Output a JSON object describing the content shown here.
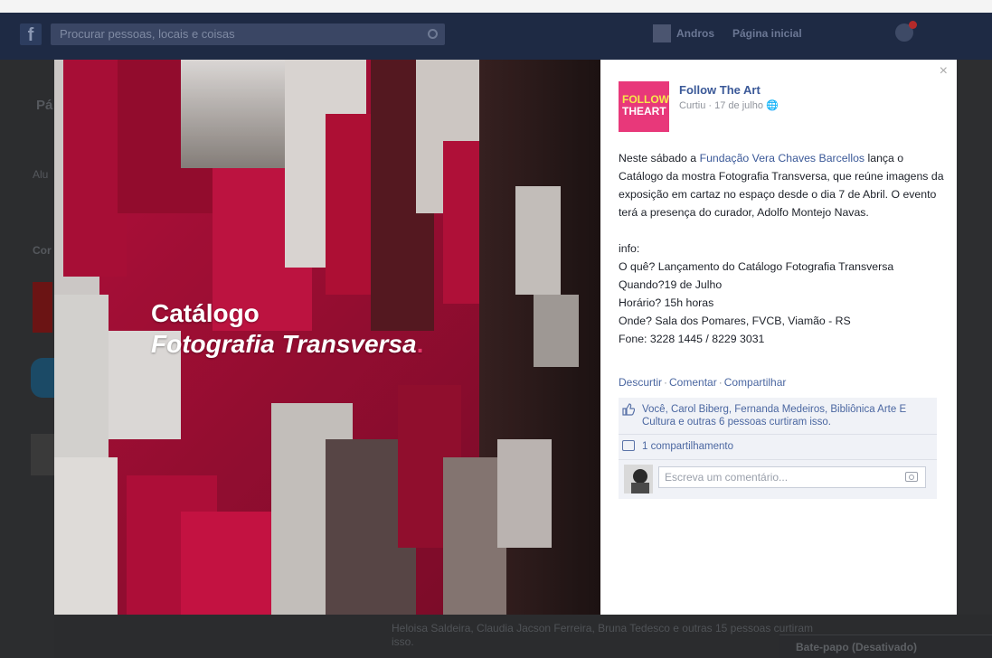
{
  "topbar": {
    "logo": "f",
    "search_placeholder": "Procurar pessoas, locais e coisas",
    "nav_profile": "Andros",
    "nav_home": "Página inicial"
  },
  "background": {
    "tab_label": "Pá",
    "left_label": "Alu",
    "left_label2": "Cor",
    "bottom_text": "Heloisa Saldeira, Claudia Jacson Ferreira, Bruna Tedesco e outras 15 pessoas curtiram isso.",
    "chat": "Bate-papo (Desativado)"
  },
  "photo": {
    "title_line1": "Catálogo",
    "title_line2": "Fotografia Transversa",
    "title_dot": "."
  },
  "post": {
    "close": "×",
    "logo_line1": "FOLLOW",
    "logo_line2": "THEART",
    "page_name": "Follow The Art",
    "meta": "Curtiu · 17 de julho",
    "text_pre": "Neste sábado a ",
    "text_link": "Fundação Vera Chaves Barcellos",
    "text_post": " lança o Catálogo da mostra Fotografia Transversa, que reúne imagens da exposição em cartaz no espaço desde o dia 7 de Abril. O evento terá a presença do curador, Adolfo Montejo Navas.",
    "info_label": "info:",
    "info_what": "O quê? Lançamento do Catálogo Fotografia Transversa",
    "info_when": "Quando?19 de Julho",
    "info_time": "Horário? 15h horas",
    "info_where": "Onde? Sala dos Pomares, FVCB, Viamão - RS",
    "info_phone": "Fone: 3228 1445 / 8229 3031",
    "action_unlike": "Descurtir",
    "action_comment": "Comentar",
    "action_share": "Compartilhar",
    "likes_text": "Você, Carol Biberg, Fernanda Medeiros, Bibliônica Arte E Cultura e outras 6 pessoas curtiram isso.",
    "shares_text": "1 compartilhamento",
    "comment_placeholder": "Escreva um comentário..."
  },
  "colors": {
    "link": "#3b5998",
    "ufi_bg": "#f0f2f7",
    "logo_pink": "#e8387a",
    "logo_yellow": "#f6e84a"
  }
}
